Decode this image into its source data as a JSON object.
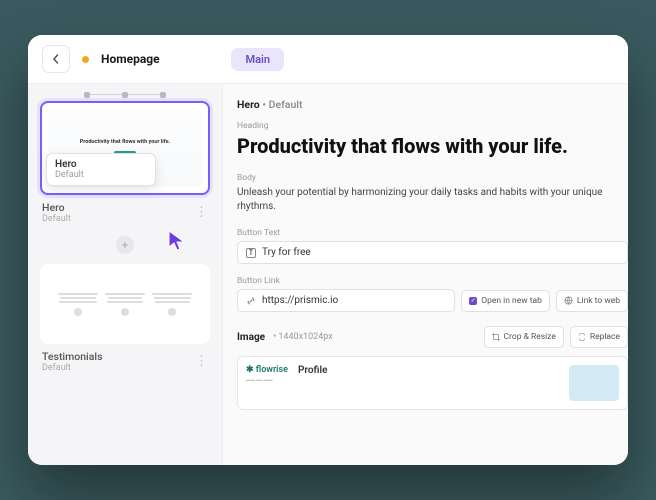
{
  "topbar": {
    "page_title": "Homepage",
    "main_tab": "Main"
  },
  "sidebar": {
    "slices": [
      {
        "name": "Hero",
        "variant": "Default",
        "thumb_heading": "Productivity that flows with your life."
      },
      {
        "index": "2",
        "name": "Testimonials",
        "variant": "Default"
      }
    ],
    "tooltip": {
      "name": "Hero",
      "variant": "Default"
    }
  },
  "editor": {
    "crumb_name": "Hero",
    "crumb_variant": "Default",
    "heading_label": "Heading",
    "heading": "Productivity that flows with your life.",
    "body_label": "Body",
    "body": "Unleash your potential by harmonizing your daily tasks and habits with your unique rhythms.",
    "button_text_label": "Button Text",
    "button_text": "Try for free",
    "button_link_label": "Button Link",
    "button_link": "https://prismic.io",
    "open_new_tab": "Open in new tab",
    "link_to_web": "Link to web",
    "image_label": "Image",
    "image_dims": "1440x1024px",
    "crop_resize": "Crop & Resize",
    "replace": "Replace",
    "preview_brand": "flowrise",
    "preview_title": "Profile"
  }
}
